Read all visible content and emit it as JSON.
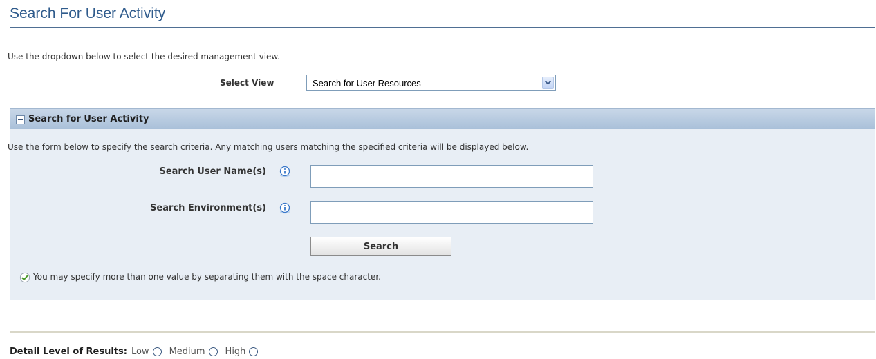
{
  "header": {
    "title": "Search For User Activity"
  },
  "intro": {
    "text": "Use the dropdown below to select the desired management view."
  },
  "select_view": {
    "label": "Select View",
    "selected": "Search for User Resources"
  },
  "panel": {
    "title": "Search for User Activity",
    "description": "Use the form below to specify the search criteria. Any matching users matching the specified criteria will be displayed below.",
    "fields": [
      {
        "label": "Search User Name(s)",
        "value": ""
      },
      {
        "label": "Search Environment(s)",
        "value": ""
      }
    ],
    "search_button": "Search",
    "hint": "You may specify more than one value by separating them with the space character."
  },
  "detail_level": {
    "label": "Detail Level of Results:",
    "options": [
      "Low",
      "Medium",
      "High"
    ]
  },
  "icons": {
    "collapse": "collapse-icon",
    "info": "info-icon",
    "hint": "checkmark-icon",
    "dropdown": "chevron-down-icon"
  },
  "colors": {
    "title": "#2f5b8c",
    "panel_background": "#e8eef5",
    "panel_header": "#b9cce2",
    "info_icon": "#3a78c9",
    "hint_icon": "#4a9a2b"
  }
}
